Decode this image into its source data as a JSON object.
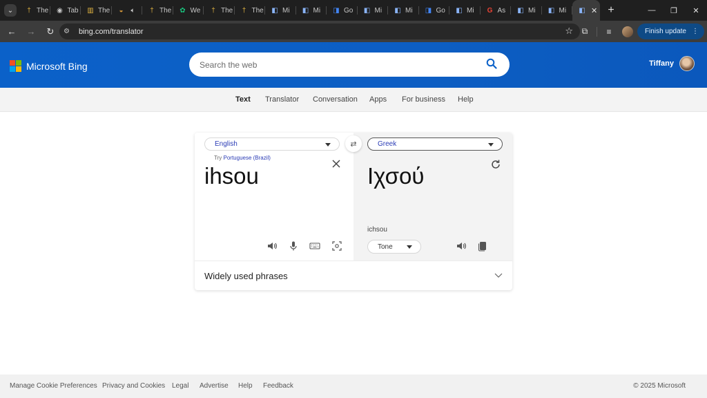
{
  "browser": {
    "tabs": [
      {
        "title": "The",
        "icon": "cross-icon"
      },
      {
        "title": "Tab",
        "icon": "globe-icon"
      },
      {
        "title": "The",
        "icon": "book-icon"
      },
      {
        "title": "",
        "icon": "audio-icon"
      },
      {
        "title": "The",
        "icon": "cross-icon"
      },
      {
        "title": "We",
        "icon": "openai-icon"
      },
      {
        "title": "The",
        "icon": "cross-icon"
      },
      {
        "title": "The",
        "icon": "cross-icon"
      },
      {
        "title": "Mi",
        "icon": "translator-icon"
      },
      {
        "title": "Mi",
        "icon": "translator-icon"
      },
      {
        "title": "Go",
        "icon": "google-translate-icon"
      },
      {
        "title": "Mi",
        "icon": "translator-icon"
      },
      {
        "title": "Mi",
        "icon": "translator-icon"
      },
      {
        "title": "Go",
        "icon": "google-translate-icon"
      },
      {
        "title": "Mi",
        "icon": "translator-icon"
      },
      {
        "title": "As",
        "icon": "google-icon"
      },
      {
        "title": "Mi",
        "icon": "translator-icon"
      },
      {
        "title": "Mi",
        "icon": "translator-icon"
      }
    ],
    "active_tab_icon": "translator-icon",
    "url": "bing.com/translator",
    "finish_update_label": "Finish update"
  },
  "header": {
    "brand": "Microsoft Bing",
    "search_placeholder": "Search the web",
    "user_name": "Tiffany"
  },
  "subnav": {
    "items": [
      "Text",
      "Translator",
      "Conversation",
      "Apps",
      "For business",
      "Help"
    ],
    "active": "Text"
  },
  "translator": {
    "source_language": "English",
    "target_language": "Greek",
    "try_prefix": "Try",
    "try_language": "Portuguese (Brazil)",
    "source_text": "ihsou",
    "translated_text": "Ιχσού",
    "transliteration": "ichsou",
    "tone_label": "Tone",
    "phrases_label": "Widely used phrases"
  },
  "footer": {
    "links": [
      "Manage Cookie Preferences",
      "Privacy and Cookies",
      "Legal",
      "Advertise",
      "Help",
      "Feedback"
    ],
    "copyright": "© 2025 Microsoft"
  },
  "colors": {
    "bing_blue": "#0b61c9",
    "link_blue": "#2a3bb5",
    "chrome_dark": "#1f1f1f"
  }
}
